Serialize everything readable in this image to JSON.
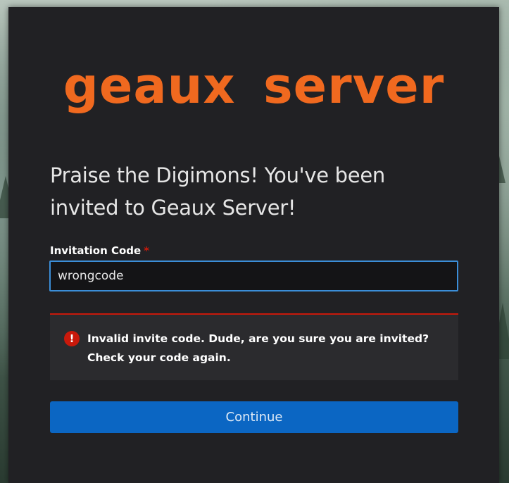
{
  "logo": {
    "text": "geaux server"
  },
  "headline": "Praise the Digimons! You've been invited to Geaux Server!",
  "form": {
    "label": "Invitation Code",
    "required_marker": "*",
    "value": "wrongcode"
  },
  "alert": {
    "icon": "exclamation-circle-icon",
    "icon_glyph": "!",
    "message": "Invalid invite code. Dude, are you sure you are invited? Check your code again."
  },
  "continue_button": {
    "label": "Continue"
  },
  "colors": {
    "brand": "#f0691f",
    "primary": "#0b66c3",
    "danger": "#c9190b",
    "focus": "#3b8ed8",
    "card": "#212124"
  }
}
